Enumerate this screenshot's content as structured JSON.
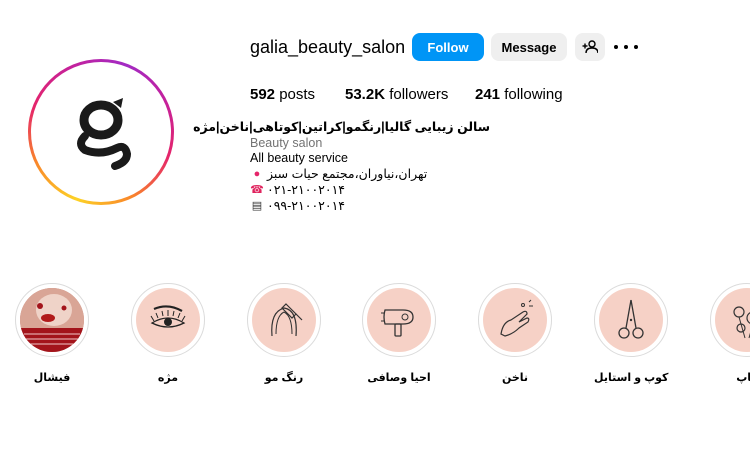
{
  "profile": {
    "username": "galia_beauty_salon",
    "follow_label": "Follow",
    "message_label": "Message",
    "stats": {
      "posts_count": "592",
      "posts_label": "posts",
      "followers_count": "53.2K",
      "followers_label": "followers",
      "following_count": "241",
      "following_label": "following"
    },
    "bio": {
      "name": "سالن زیبایی گالیا|رنگمو|کراتین|کوتاهی|ناخن|مژه",
      "category": "Beauty salon",
      "line1": "All beauty service",
      "address": "تهران،نیاوران،مجتمع حیات سبز",
      "phone": "۰۲۱-۲۱۰۰۲۰۱۴",
      "mobile": "۰۹۹-۲۱۰۰۲۰۱۴"
    }
  },
  "highlights": [
    {
      "label": "فیشال",
      "icon": "facial-photo"
    },
    {
      "label": "مژه",
      "icon": "eyelash-icon"
    },
    {
      "label": "رنگ مو",
      "icon": "hair-color-icon"
    },
    {
      "label": "احیا وصافی",
      "icon": "hair-dryer-icon"
    },
    {
      "label": "ناخن",
      "icon": "nail-icon"
    },
    {
      "label": "کوپ و استایل",
      "icon": "scissors-icon"
    },
    {
      "label": "کاپ",
      "icon": "flowers-icon"
    }
  ],
  "colors": {
    "accent": "#0095f6",
    "highlight_bg": "#f6d1c6",
    "muted": "#737373"
  }
}
